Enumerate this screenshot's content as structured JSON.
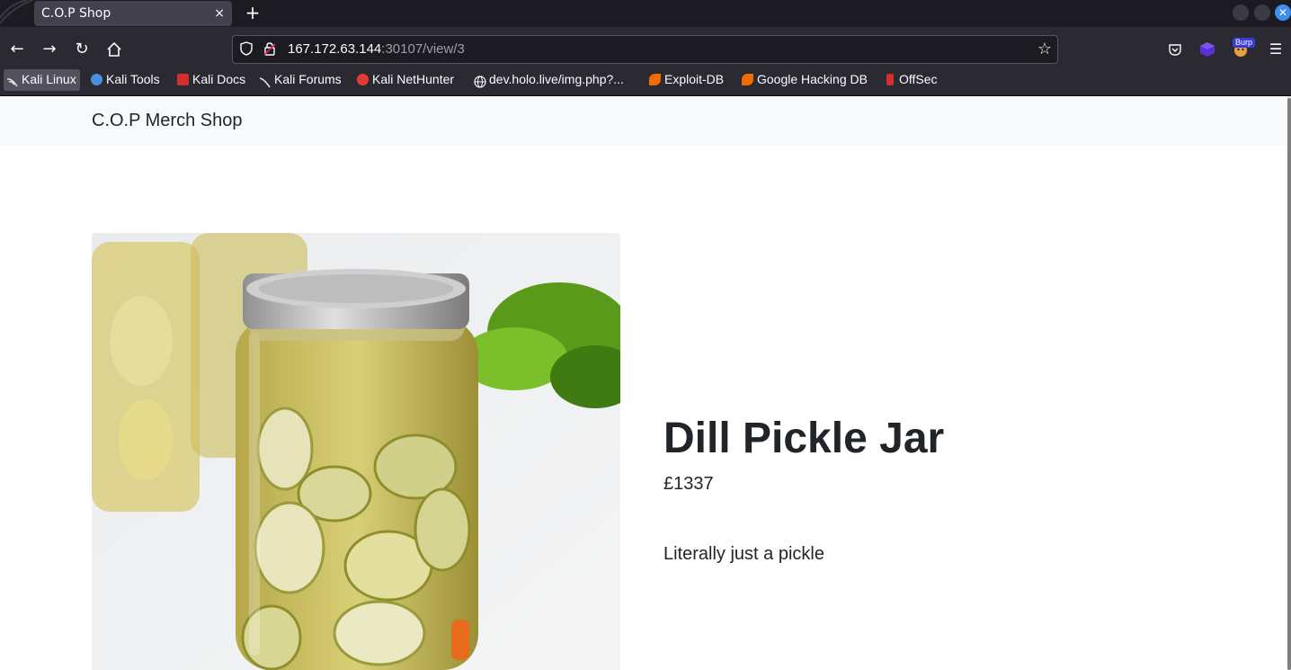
{
  "browser": {
    "tab_title": "C.O.P Shop",
    "tab_close": "×",
    "new_tab": "+",
    "url_host": "167.172.63.144",
    "url_path": ":30107/view/3",
    "burp_label": "Burp",
    "bookmarks": [
      {
        "label": "Kali Linux",
        "icon": "kali-icon",
        "color": "#d9d9d9"
      },
      {
        "label": "Kali Tools",
        "icon": "kali-tools-icon",
        "color": "#4a90e2"
      },
      {
        "label": "Kali Docs",
        "icon": "kali-docs-icon",
        "color": "#d32f2f"
      },
      {
        "label": "Kali Forums",
        "icon": "kali-forums-icon",
        "color": "#d9d9d9"
      },
      {
        "label": "Kali NetHunter",
        "icon": "nethunter-icon",
        "color": "#e53935"
      },
      {
        "label": "dev.holo.live/img.php?...",
        "icon": "globe-icon",
        "color": "#fbfbfe"
      },
      {
        "label": "Exploit-DB",
        "icon": "exploit-db-icon",
        "color": "#ef6c00"
      },
      {
        "label": "Google Hacking DB",
        "icon": "ghdb-icon",
        "color": "#ef6c00"
      },
      {
        "label": "OffSec",
        "icon": "offsec-icon",
        "color": "#d32f2f"
      }
    ]
  },
  "shop": {
    "brand": "C.O.P Merch Shop",
    "product": {
      "title": "Dill Pickle Jar",
      "price": "£1337",
      "description": "Literally just a pickle",
      "image": "pickle-jar-image"
    }
  },
  "colors": {
    "browser_chrome": "#2b2a33",
    "tab_strip": "#1c1b22",
    "shop_nav_bg": "#f8f9fa",
    "text": "#212529"
  }
}
